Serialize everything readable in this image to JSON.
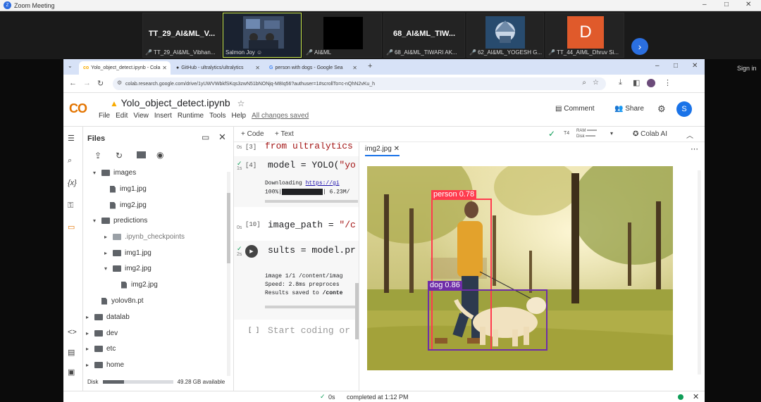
{
  "zoom": {
    "title": "Zoom Meeting",
    "tiles": [
      {
        "big": "TT_29_AI&ML_V...",
        "label": "TT_29_AI&ML_Vibhan..."
      },
      {
        "big": "",
        "label": "Salmon Joy"
      },
      {
        "big": "",
        "label": "AI&ML"
      },
      {
        "big": "68_AI&ML_TIW...",
        "label": "68_AI&ML_TIWARI AK..."
      },
      {
        "big": "",
        "label": "62_AI&ML_YOGESH G..."
      },
      {
        "big": "D",
        "label": "TT_44_AIML_Dhruv Si..."
      }
    ],
    "sign_in": "Sign in"
  },
  "browser": {
    "tabs": [
      {
        "label": "Yolo_object_detect.ipynb - Cola"
      },
      {
        "label": "GitHub - ultralytics/ultralytics"
      },
      {
        "label": "person with dogs - Google Sea"
      }
    ],
    "new_tab": "+",
    "url": "colab.research.google.com/drive/1yUWVWbkfSKqs3zwN51bNONjq-M8Iq56?authuser=1#scrollTo=c-nQhN2vKu_h"
  },
  "colab": {
    "logo": "CO",
    "title": "Yolo_object_detect.ipynb",
    "menu": [
      "File",
      "Edit",
      "View",
      "Insert",
      "Runtime",
      "Tools",
      "Help"
    ],
    "saved": "All changes saved",
    "comment": "Comment",
    "share": "Share",
    "avatar": "S",
    "add_code": "+ Code",
    "add_text": "+ Text",
    "ram": "RAM",
    "disk_label": "Disk",
    "colab_ai": "Colab AI",
    "t4": "T4"
  },
  "files": {
    "title": "Files",
    "tree": [
      {
        "name": "images",
        "type": "folder",
        "depth": 1,
        "open": true
      },
      {
        "name": "img1.jpg",
        "type": "file",
        "depth": 2
      },
      {
        "name": "img2.jpg",
        "type": "file",
        "depth": 2
      },
      {
        "name": "predictions",
        "type": "folder",
        "depth": 1,
        "open": true
      },
      {
        "name": ".ipynb_checkpoints",
        "type": "folder-light",
        "depth": 2,
        "open": false
      },
      {
        "name": "img1.jpg",
        "type": "folder",
        "depth": 2,
        "open": false
      },
      {
        "name": "img2.jpg",
        "type": "folder",
        "depth": 2,
        "open": true
      },
      {
        "name": "img2.jpg",
        "type": "file",
        "depth": 3
      },
      {
        "name": "yolov8n.pt",
        "type": "file",
        "depth": 1
      },
      {
        "name": "datalab",
        "type": "folder",
        "depth": 0,
        "open": false
      },
      {
        "name": "dev",
        "type": "folder",
        "depth": 0,
        "open": false
      },
      {
        "name": "etc",
        "type": "folder",
        "depth": 0,
        "open": false
      },
      {
        "name": "home",
        "type": "folder",
        "depth": 0,
        "open": false
      }
    ],
    "disk_text": "49.28 GB available",
    "disk_label": "Disk",
    "disk_used_fraction": 0.3
  },
  "cells": {
    "c3": {
      "num": "[3]",
      "code": "from ultralytics"
    },
    "c4": {
      "num": "[4]",
      "code_a": "model = YOLO(",
      "code_b": "\"yo",
      "out1": "Downloading ",
      "out1_link": "https://gi",
      "out2": "100%|",
      "out2b": "| 6.23M/"
    },
    "c10": {
      "num": "[10]",
      "code_a": "image_path = ",
      "code_b": "\"/c"
    },
    "c11": {
      "code": "sults = model.pr",
      "out1": "image 1/1 /content/imag",
      "out2": "Speed: 2.8ms preproces",
      "out3a": "Results saved to ",
      "out3b": "/conte"
    },
    "empty": {
      "num": "[ ]",
      "placeholder": "Start coding or"
    },
    "time_1s": "1s",
    "time_0s": "0s",
    "time_2s": "2s"
  },
  "viewer": {
    "tab": "img2.jpg",
    "detections": [
      {
        "label": "person 0.78",
        "color": "#ff3b4e"
      },
      {
        "label": "dog 0.86",
        "color": "#6f2da8"
      }
    ]
  },
  "status": {
    "check": "✓",
    "time": "0s",
    "text": "completed at 1:12 PM"
  }
}
